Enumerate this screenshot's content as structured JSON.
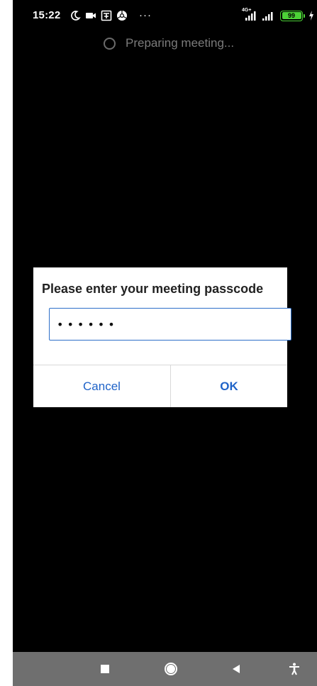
{
  "status_bar": {
    "time": "15:22",
    "icons_left": [
      "moon-icon",
      "video-camera-icon",
      "app-icon",
      "chrome-icon"
    ],
    "more_dots": "···",
    "network_label": "4G+",
    "icons_right": [
      "signal-4g-icon",
      "signal-icon",
      "battery-icon",
      "charging-icon"
    ],
    "battery_level": "99",
    "battery_color": "#4cd137"
  },
  "main": {
    "preparing_text": "Preparing meeting..."
  },
  "dialog": {
    "title": "Please enter your meeting passcode",
    "passcode_value": "••••••",
    "cancel_label": "Cancel",
    "ok_label": "OK",
    "accent_color": "#1f63c8"
  },
  "nav_bar": {
    "items": [
      "recents-icon",
      "home-icon",
      "back-icon",
      "accessibility-icon"
    ]
  }
}
